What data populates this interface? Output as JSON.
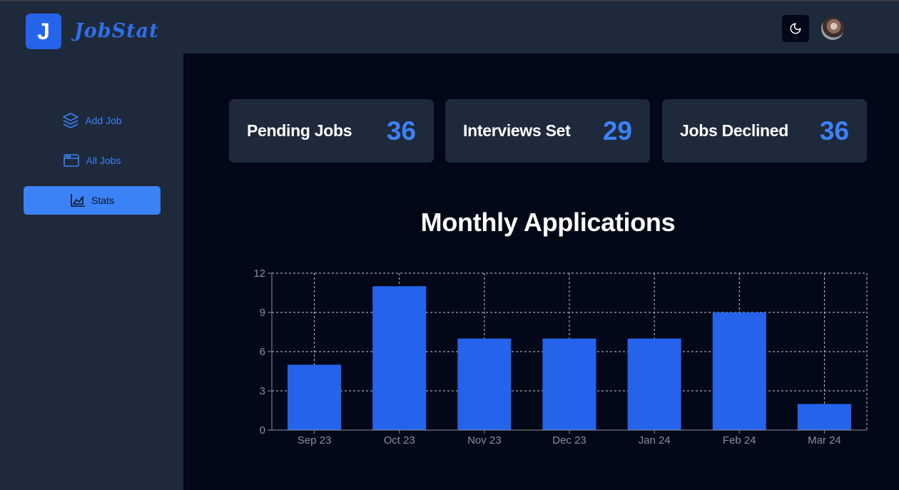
{
  "app": {
    "logo_letter": "J",
    "name": "JobStat"
  },
  "header": {
    "theme_icon": "moon-icon",
    "avatar": "user-avatar"
  },
  "sidebar": {
    "items": [
      {
        "label": "Add Job",
        "icon": "layers-icon",
        "active": false
      },
      {
        "label": "All Jobs",
        "icon": "browser-window-icon",
        "active": false
      },
      {
        "label": "Stats",
        "icon": "area-chart-icon",
        "active": true
      }
    ]
  },
  "stats": [
    {
      "label": "Pending Jobs",
      "value": "36"
    },
    {
      "label": "Interviews Set",
      "value": "29"
    },
    {
      "label": "Jobs Declined",
      "value": "36"
    }
  ],
  "colors": {
    "accent": "#3b82f6",
    "bar": "#2563eb",
    "surface": "#1e293b",
    "background": "#020817"
  },
  "chart_data": {
    "type": "bar",
    "title": "Monthly Applications",
    "categories": [
      "Sep 23",
      "Oct 23",
      "Nov 23",
      "Dec 23",
      "Jan 24",
      "Feb 24",
      "Mar 24"
    ],
    "values": [
      5,
      11,
      7,
      7,
      7,
      9,
      2
    ],
    "ylim": [
      0,
      12
    ],
    "yticks": [
      0,
      3,
      6,
      9,
      12
    ],
    "grid": true
  }
}
